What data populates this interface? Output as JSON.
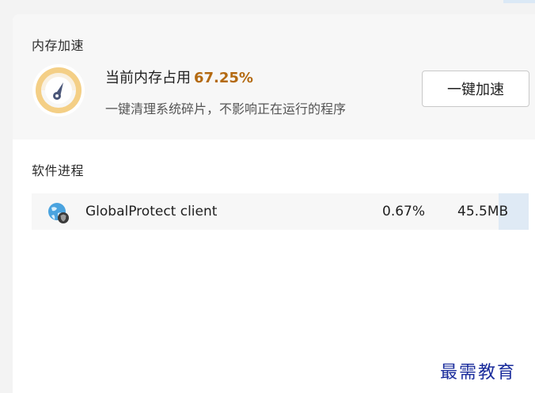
{
  "boost": {
    "section_title": "内存加速",
    "memory_label": "当前内存占用",
    "memory_value": "67.25%",
    "memory_level": 0.6725,
    "description": "一键清理系统碎片，不影响正在运行的程序",
    "button_label": "一键加速",
    "icon": "speedometer-icon",
    "accent_color": "#b46a12",
    "gauge_color": "#f4cf86"
  },
  "processes": {
    "section_title": "软件进程",
    "rows": [
      {
        "name": "GlobalProtect client",
        "cpu": "0.67%",
        "memory": "45.5MB",
        "icon": "globe-shield-icon"
      }
    ]
  },
  "watermark": {
    "text": "最需教育"
  }
}
